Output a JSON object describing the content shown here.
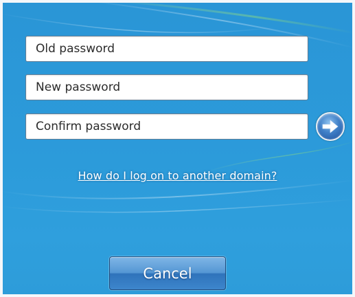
{
  "fields": {
    "old_password": {
      "value": "",
      "placeholder": "Old password"
    },
    "new_password": {
      "value": "",
      "placeholder": "New password"
    },
    "confirm_password": {
      "value": "",
      "placeholder": "Confirm password"
    }
  },
  "submit": {
    "icon": "arrow-right-icon"
  },
  "link": {
    "label": "How do I log on to another domain?"
  },
  "buttons": {
    "cancel_label": "Cancel"
  },
  "colors": {
    "background": "#2c9bda",
    "accent": "#3f7fc7",
    "link": "#ffffff"
  }
}
